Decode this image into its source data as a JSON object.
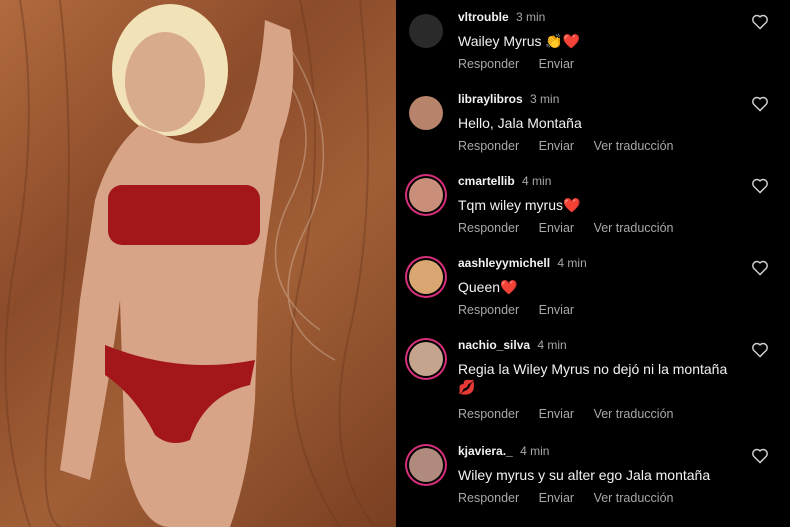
{
  "actions": {
    "reply": "Responder",
    "send": "Enviar",
    "translate": "Ver traducción"
  },
  "comments": [
    {
      "user": "vltrouble",
      "time": "3 min",
      "text": "Wailey Myrus 👏❤️",
      "translate": false,
      "avatar_color": "#2a2a2a",
      "ring": false
    },
    {
      "user": "libraylibros",
      "time": "3 min",
      "text": "Hello, Jala Montaña",
      "translate": true,
      "avatar_color": "#b7836a",
      "ring": false
    },
    {
      "user": "cmartellib",
      "time": "4 min",
      "text": "Tqm wiley myrus❤️",
      "translate": true,
      "avatar_color": "#c98f7a",
      "ring": true
    },
    {
      "user": "aashleyymichell",
      "time": "4 min",
      "text": "Queen❤️",
      "translate": false,
      "avatar_color": "#d9a571",
      "ring": true
    },
    {
      "user": "nachio_silva",
      "time": "4 min",
      "text": "Regia la Wiley Myrus no dejó ni la montaña 💋",
      "translate": true,
      "avatar_color": "#c4a48c",
      "ring": true
    },
    {
      "user": "kjaviera._",
      "time": "4 min",
      "text": "Wiley myrus y su alter ego Jala montaña",
      "translate": true,
      "avatar_color": "#b08a7c",
      "ring": true
    }
  ],
  "colors": {
    "accent_ring": "#d62f7a",
    "heart": "#e0162b",
    "muted": "#a8a8a8",
    "text": "#f2f2f2"
  },
  "icons": {
    "like": "heart-outline-icon"
  }
}
